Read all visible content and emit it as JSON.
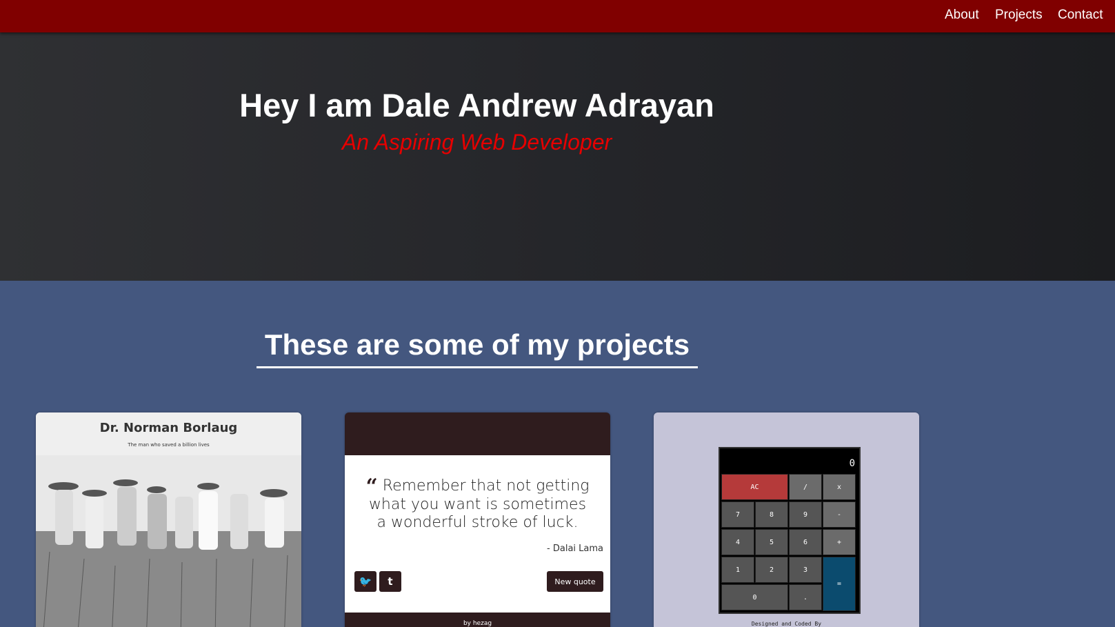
{
  "nav": {
    "links": [
      "About",
      "Projects",
      "Contact"
    ]
  },
  "hero": {
    "title": "Hey I am Dale Andrew Adrayan",
    "subtitle": "An Aspiring Web Developer"
  },
  "projects": {
    "heading": "These are some of my projects",
    "tribute": {
      "title": "Dr. Norman Borlaug",
      "tagline": "The man who saved a billion lives"
    },
    "quote": {
      "text": "Remember that not getting what you want is sometimes a wonderful stroke of luck.",
      "author": "- Dalai Lama",
      "new_quote_label": "New quote",
      "twitter_glyph": "🐦",
      "tumblr_glyph": "t",
      "footer": "by hezag"
    },
    "calculator": {
      "display": "0",
      "keys": [
        "AC",
        "/",
        "x",
        "7",
        "8",
        "9",
        "-",
        "4",
        "5",
        "6",
        "+",
        "1",
        "2",
        "3",
        "=",
        "0",
        "."
      ],
      "footer": "Designed and Coded By"
    }
  },
  "colors": {
    "navbar": "#800000",
    "subtitle": "#e60000",
    "section_bg": "#44577f"
  }
}
